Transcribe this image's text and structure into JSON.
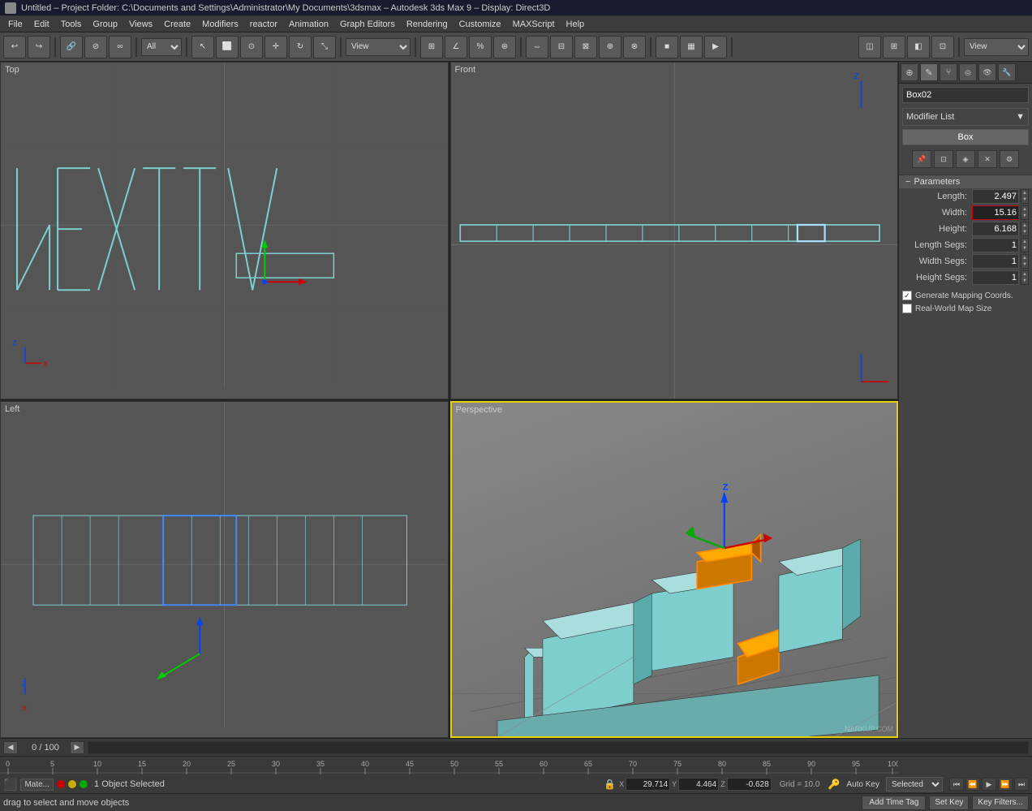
{
  "titleBar": {
    "icon": "3dsmax-icon",
    "title": "Untitled  –  Project Folder: C:\\Documents and Settings\\Administrator\\My Documents\\3dsmax  –  Autodesk 3ds Max 9  –  Display: Direct3D"
  },
  "menuBar": {
    "items": [
      "File",
      "Edit",
      "Tools",
      "Group",
      "Views",
      "Create",
      "Modifiers",
      "reactor",
      "Animation",
      "Graph Editors",
      "Rendering",
      "Customize",
      "MAXScript",
      "Help"
    ]
  },
  "toolbar": {
    "filterLabel": "All",
    "viewLabel": "View"
  },
  "viewports": {
    "topLeft": {
      "label": "Top"
    },
    "topRight": {
      "label": "Front"
    },
    "bottomLeft": {
      "label": "Left"
    },
    "bottomRight": {
      "label": "Perspective"
    }
  },
  "rightPanel": {
    "tabs": [
      "cmd1",
      "cmd2",
      "cmd3",
      "cmd4",
      "cmd5",
      "cmd6",
      "cmd7",
      "cmd8"
    ],
    "objectName": "Box02",
    "modifierListLabel": "Modifier List",
    "modifierType": "Box",
    "parameters": {
      "header": "Parameters",
      "length": {
        "label": "Length:",
        "value": "2.497"
      },
      "width": {
        "label": "Width:",
        "value": "15.16",
        "active": true
      },
      "height": {
        "label": "Height:",
        "value": "6.168"
      },
      "lengthSegs": {
        "label": "Length Segs:",
        "value": "1"
      },
      "widthSegs": {
        "label": "Width Segs:",
        "value": "1"
      },
      "heightSegs": {
        "label": "Height Segs:",
        "value": "1"
      }
    },
    "checkboxes": {
      "generateMapping": {
        "label": "Generate Mapping Coords.",
        "checked": true
      },
      "realWorldMap": {
        "label": "Real-World Map Size",
        "checked": false
      }
    }
  },
  "timeline": {
    "counter": "0 / 100",
    "markers": [
      "0",
      "5",
      "10",
      "15",
      "20",
      "25",
      "30",
      "35",
      "40",
      "45",
      "50",
      "55",
      "60",
      "65",
      "70",
      "75",
      "80",
      "85",
      "90",
      "95",
      "100"
    ]
  },
  "statusBar": {
    "objectSelectedText": "1 Object Selected",
    "dragHintText": "drag to select and move objects",
    "xCoord": "29.714",
    "yCoord": "4.464",
    "zCoord": "-0.628",
    "gridLabel": "Grid = 10.0",
    "autoKeyLabel": "Auto Key",
    "selectedLabel": "Selected",
    "setKeyLabel": "Set Key",
    "keyFiltersLabel": "Key Filters..."
  },
  "icons": {
    "undo": "↩",
    "redo": "↪",
    "select": "↖",
    "move": "✛",
    "rotate": "↻",
    "scale": "⤡",
    "link": "🔗",
    "unlink": "⊘",
    "bind": "∞",
    "camera": "📷",
    "light": "💡",
    "spinner-up": "▲",
    "spinner-down": "▼",
    "chevron-down": "▼",
    "minus": "−",
    "lock": "🔒",
    "key": "🔑",
    "play": "▶",
    "prev-frame": "◀◀",
    "next-frame": "▶▶",
    "stop": "■",
    "play-back": "◀",
    "play-fwd": "▶"
  }
}
